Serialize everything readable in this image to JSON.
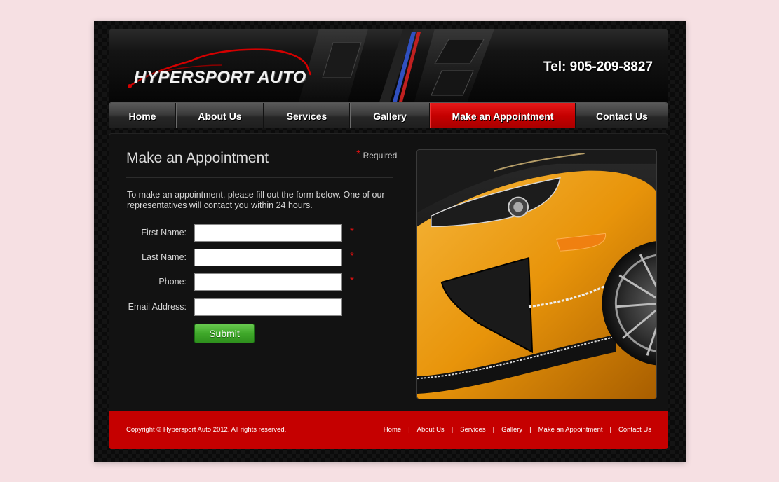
{
  "header": {
    "logo_text": "HYPERSPORT AUTO",
    "phone": "Tel: 905-209-8827"
  },
  "nav": {
    "items": [
      {
        "label": "Home"
      },
      {
        "label": "About Us"
      },
      {
        "label": "Services"
      },
      {
        "label": "Gallery"
      },
      {
        "label": "Make an Appointment",
        "active": true
      },
      {
        "label": "Contact Us"
      }
    ]
  },
  "main": {
    "title": "Make an Appointment",
    "required_star": "*",
    "required_label": "Required",
    "intro": "To make an appointment, please fill out the form below. One of our representatives will contact you within 24 hours.",
    "fields": [
      {
        "label": "First Name:",
        "value": "",
        "required": "*"
      },
      {
        "label": "Last Name:",
        "value": "",
        "required": "*"
      },
      {
        "label": "Phone:",
        "value": "",
        "required": "*"
      },
      {
        "label": "Email Address:",
        "value": ""
      }
    ],
    "submit_label": "Submit"
  },
  "footer": {
    "copyright": "Copyright © Hypersport Auto 2012. All rights reserved.",
    "links": [
      "Home",
      "About Us",
      "Services",
      "Gallery",
      "Make an Appointment",
      "Contact Us"
    ],
    "separator": "|"
  },
  "colors": {
    "accent_red": "#c50000",
    "submit_green": "#3fa82a",
    "car_orange": "#e8940a"
  },
  "icons": {
    "logo_swoosh": "car-silhouette-icon"
  }
}
